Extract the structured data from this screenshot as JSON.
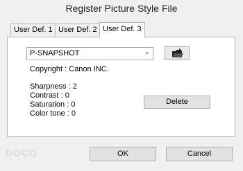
{
  "window": {
    "title": "Register Picture Style File"
  },
  "tabs": [
    {
      "label": "User Def. 1",
      "active": false
    },
    {
      "label": "User Def. 2",
      "active": false
    },
    {
      "label": "User Def. 3",
      "active": true
    }
  ],
  "style_select": {
    "value": "P-SNAPSHOT"
  },
  "copyright": "Copyright : Canon INC.",
  "parameters": {
    "sharpness": "Sharpness : 2",
    "contrast": "Contrast : 0",
    "saturation": "Saturation : 0",
    "color_tone": "Color tone : 0"
  },
  "buttons": {
    "delete": "Delete",
    "ok": "OK",
    "cancel": "Cancel",
    "open_icon": "folder-open-icon"
  },
  "watermark": "DOCO"
}
